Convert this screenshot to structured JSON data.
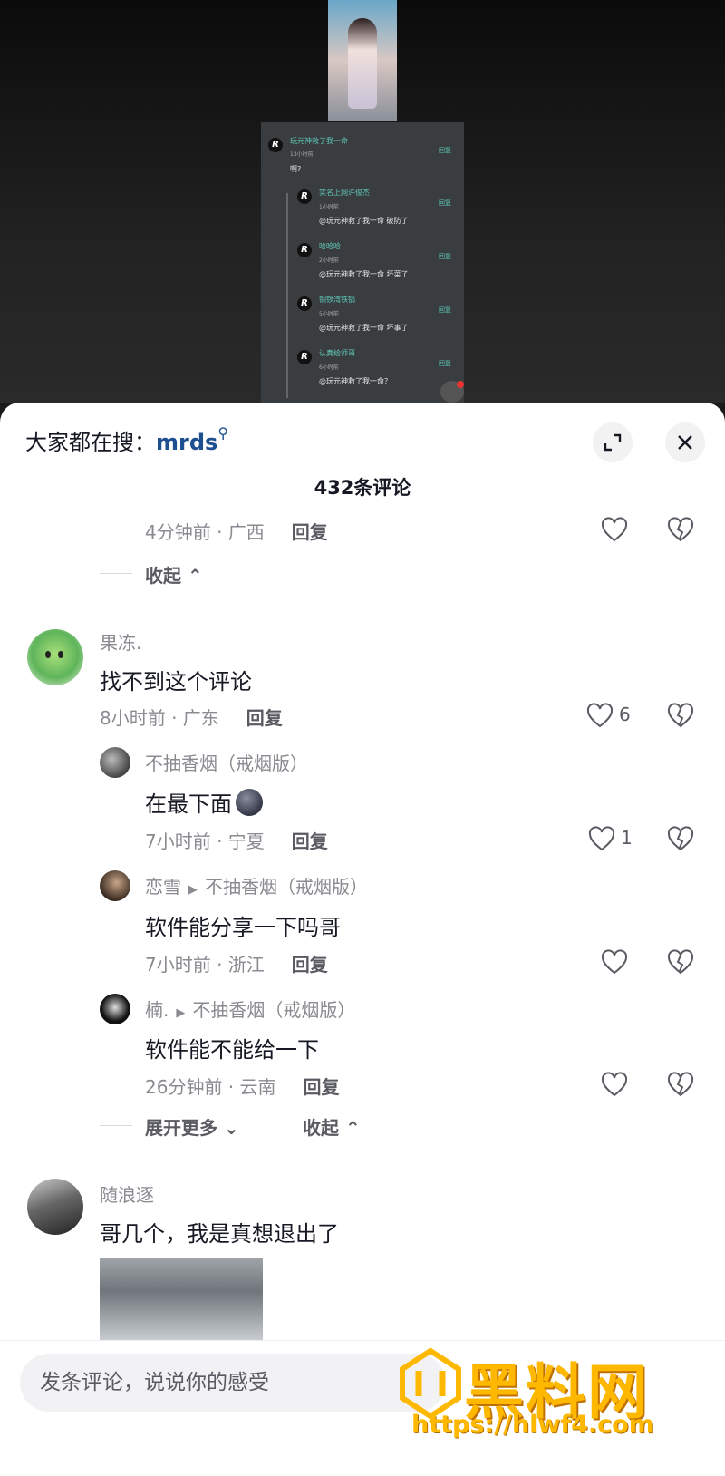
{
  "video_screenshot": {
    "main_comment": {
      "name": "玩元神救了我一命",
      "time": "13小时前",
      "text": "啊?",
      "reply": "回复"
    },
    "replies": [
      {
        "name": "实名上网许俊杰",
        "time": "1小时前",
        "text": "@玩元神救了我一命 破防了",
        "reply": "回复"
      },
      {
        "name": "哈哈哈",
        "time": "2小时前",
        "text": "@玩元神救了我一命 坏菜了",
        "reply": "回复"
      },
      {
        "name": "铜锣湾铁锅",
        "time": "5小时前",
        "text": "@玩元神救了我一命 坏事了",
        "reply": "回复"
      },
      {
        "name": "认真给师哥",
        "time": "6小时前",
        "text": "@玩元神救了我一命？",
        "reply": "回复"
      }
    ]
  },
  "header": {
    "search_prefix": "大家都在搜：",
    "search_keyword": "mrds",
    "comment_count": "432条评论"
  },
  "prev_thread": {
    "meta": "4分钟前 · 广西",
    "reply": "回复",
    "collapse": "收起"
  },
  "comment1": {
    "name": "果冻.",
    "text": "找不到这个评论",
    "meta": "8小时前 · 广东",
    "reply": "回复",
    "likes": "6"
  },
  "replies": [
    {
      "name": "不抽香烟（戒烟版）",
      "text": "在最下面",
      "meta": "7小时前 · 宁夏",
      "reply": "回复",
      "likes": "1"
    },
    {
      "name": "恋雪",
      "target": "不抽香烟（戒烟版）",
      "text": "软件能分享一下吗哥",
      "meta": "7小时前 · 浙江",
      "reply": "回复"
    },
    {
      "name": "楠.",
      "target": "不抽香烟（戒烟版）",
      "text": "软件能不能给一下",
      "meta": "26分钟前 · 云南",
      "reply": "回复"
    }
  ],
  "thread_controls": {
    "expand_more": "展开更多",
    "collapse": "收起"
  },
  "comment2": {
    "name": "随浪逐",
    "text": "哥几个，我是真想退出了"
  },
  "input": {
    "placeholder": "发条评论，说说你的感受"
  },
  "watermark": {
    "title": "黑料网",
    "url": "https://hlwf4.com"
  },
  "colors": {
    "keyword": "#1d4f91",
    "watermark": "#ffb800",
    "secondary_text": "#8a8b91"
  }
}
